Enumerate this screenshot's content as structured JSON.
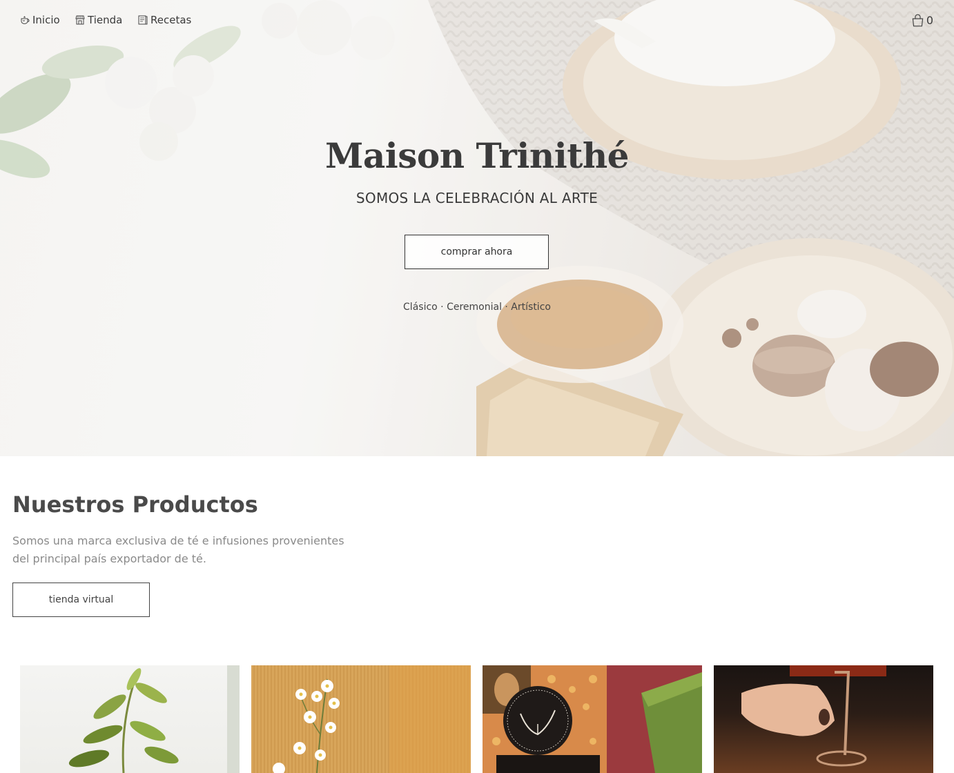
{
  "nav": {
    "items": [
      {
        "label": "Inicio",
        "icon": "teapot-icon"
      },
      {
        "label": "Tienda",
        "icon": "store-icon"
      },
      {
        "label": "Recetas",
        "icon": "recipe-book-icon"
      }
    ],
    "cart": {
      "icon": "shopping-bag-icon",
      "count": "0"
    }
  },
  "hero": {
    "title": "Maison Trinithé",
    "subtitle": "SOMOS LA CELEBRACIÓN AL ARTE",
    "button_label": "comprar ahora",
    "tags": "Clásico · Ceremonial · Artístico"
  },
  "products": {
    "title": "Nuestros Productos",
    "description": "Somos una marca exclusiva de té e infusiones provenientes del principal país exportador de té.",
    "button_label": "tienda virtual",
    "cards": [
      {
        "image": "green-plant-branch-photo"
      },
      {
        "image": "white-flowers-cardboard-photo"
      },
      {
        "image": "mona-lisa-tea-box-photo"
      },
      {
        "image": "hand-wine-glass-photo"
      }
    ]
  },
  "colors": {
    "text_dark": "#3b3b3b",
    "text_muted": "#8a8a8a",
    "border": "#333333",
    "background": "#ffffff"
  }
}
